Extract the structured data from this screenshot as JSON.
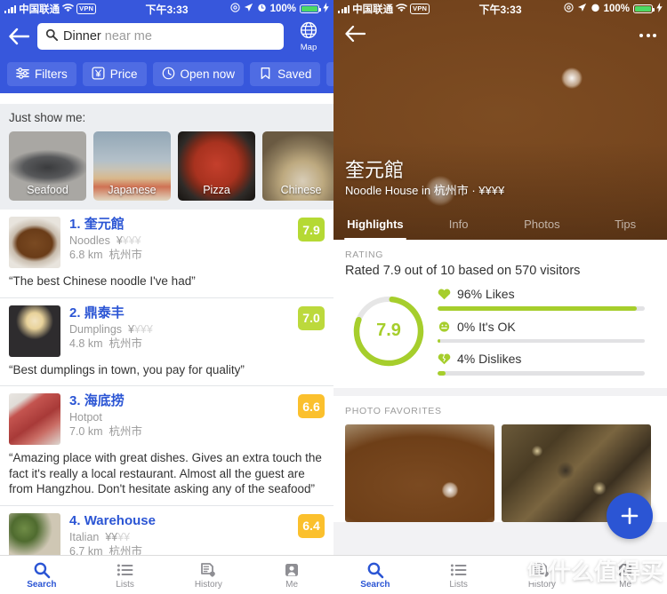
{
  "status_bar": {
    "carrier": "中国联通",
    "time": "下午3:33",
    "battery": "100%",
    "vpn": "VPN"
  },
  "search_screen": {
    "back_icon": "back-arrow-icon",
    "search": {
      "icon": "search-icon",
      "value": "Dinner",
      "placeholder": "near me"
    },
    "map_button": {
      "icon": "globe-icon",
      "label": "Map"
    },
    "filters": [
      {
        "label": "Filters",
        "icon": "sliders-icon"
      },
      {
        "label": "Price",
        "icon": "yen-box-icon"
      },
      {
        "label": "Open now",
        "icon": "clock-icon"
      },
      {
        "label": "Saved",
        "icon": "bookmark-icon"
      },
      {
        "label": "",
        "icon": "clock-icon"
      }
    ],
    "just_show_me": "Just show me:",
    "categories": [
      {
        "label": "Seafood"
      },
      {
        "label": "Japanese"
      },
      {
        "label": "Pizza"
      },
      {
        "label": "Chinese"
      },
      {
        "label": ""
      }
    ],
    "results": [
      {
        "rank": "1.",
        "name": "奎元館",
        "cuisine": "Noodles",
        "price_on": "¥",
        "price_off": "¥¥¥",
        "distance": "6.8 km",
        "city": "杭州市",
        "score": "7.9",
        "score_color": "#b5d934",
        "quote": "“The best Chinese noodle I've had”"
      },
      {
        "rank": "2.",
        "name": "鼎泰丰",
        "cuisine": "Dumplings",
        "price_on": "¥",
        "price_off": "¥¥¥",
        "distance": "4.8 km",
        "city": "杭州市",
        "score": "7.0",
        "score_color": "#bcd93c",
        "quote": "“Best dumplings in town, you pay for quality”"
      },
      {
        "rank": "3.",
        "name": "海底捞",
        "cuisine": "Hotpot",
        "price_on": "",
        "price_off": "",
        "distance": "7.0 km",
        "city": "杭州市",
        "score": "6.6",
        "score_color": "#fbc02d",
        "quote": "“Amazing place with great dishes. Gives an extra touch the fact it's really a local restaurant. Almost all the guest are from Hangzhou. Don't hesitate asking any of the seafood”"
      },
      {
        "rank": "4.",
        "name": "Warehouse",
        "cuisine": "Italian",
        "price_on": "¥¥",
        "price_off": "¥¥",
        "distance": "6.7 km",
        "city": "杭州市",
        "score": "6.4",
        "score_color": "#fbc02d",
        "quote": ""
      }
    ],
    "tabbar": [
      {
        "label": "Search",
        "icon": "search-icon",
        "active": true
      },
      {
        "label": "Lists",
        "icon": "list-icon",
        "active": false
      },
      {
        "label": "History",
        "icon": "history-icon",
        "active": false
      },
      {
        "label": "Me",
        "icon": "person-icon",
        "active": false
      }
    ]
  },
  "detail_screen": {
    "back_icon": "back-arrow-icon",
    "more_icon": "more-dots-icon",
    "venue_name": "奎元館",
    "venue_subtitle": "Noodle House in 杭州市 · ¥¥¥¥",
    "tabs": [
      {
        "label": "Highlights",
        "active": true
      },
      {
        "label": "Info",
        "active": false
      },
      {
        "label": "Photos",
        "active": false
      },
      {
        "label": "Tips",
        "active": false
      }
    ],
    "rating": {
      "section_label": "RATING",
      "summary": "Rated 7.9 out of 10 based on 570 visitors",
      "score": "7.9",
      "score_pct": 79,
      "accent_color": "#a6ce2c",
      "breakdown": [
        {
          "label": "96% Likes",
          "pct": 96,
          "icon": "heart-icon"
        },
        {
          "label": "0% It's OK",
          "pct": 1,
          "icon": "neutral-face-icon"
        },
        {
          "label": "4% Dislikes",
          "pct": 4,
          "icon": "broken-heart-icon"
        }
      ]
    },
    "photos": {
      "section_label": "PHOTO FAVORITES",
      "items": [
        {
          "alt": "broth-bowl"
        },
        {
          "alt": "noodles-with-beef"
        }
      ]
    },
    "fab": {
      "icon": "plus-icon",
      "color": "#2b55d4"
    },
    "watermark": "什么值得买",
    "tabbar": [
      {
        "label": "Search",
        "icon": "search-icon",
        "active": true
      },
      {
        "label": "Lists",
        "icon": "list-icon",
        "active": false
      },
      {
        "label": "History",
        "icon": "history-icon",
        "active": false
      },
      {
        "label": "Me",
        "icon": "person-icon",
        "active": false
      }
    ]
  }
}
